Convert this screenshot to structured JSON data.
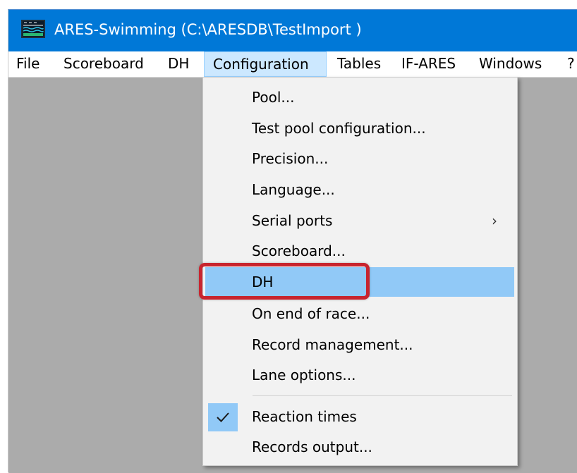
{
  "window": {
    "title": "ARES-Swimming (C:\\ARESDB\\TestImport )",
    "icon": "app-pool-icon"
  },
  "menubar": {
    "items": [
      {
        "label": "File"
      },
      {
        "label": "Scoreboard"
      },
      {
        "label": "DH"
      },
      {
        "label": "Configuration",
        "active": true
      },
      {
        "label": "Tables"
      },
      {
        "label": "IF-ARES"
      },
      {
        "label": "Windows"
      },
      {
        "label": "?"
      }
    ]
  },
  "configuration_menu": {
    "items": [
      {
        "label": "Pool..."
      },
      {
        "label": "Test pool configuration..."
      },
      {
        "label": "Precision..."
      },
      {
        "label": "Language..."
      },
      {
        "label": "Serial ports",
        "submenu": true,
        "submenu_glyph": "›"
      },
      {
        "label": "Scoreboard..."
      },
      {
        "label": "DH",
        "highlighted": true
      },
      {
        "label": "On end of race..."
      },
      {
        "label": "Record management..."
      },
      {
        "label": "Lane options..."
      },
      {
        "label": "Reaction times",
        "checked": true
      },
      {
        "label": "Records output..."
      }
    ]
  },
  "colors": {
    "titlebar": "#0078d7",
    "menu_hover": "#91c9f7",
    "menu_active": "#cce8ff",
    "annotation": "#c8242e"
  }
}
